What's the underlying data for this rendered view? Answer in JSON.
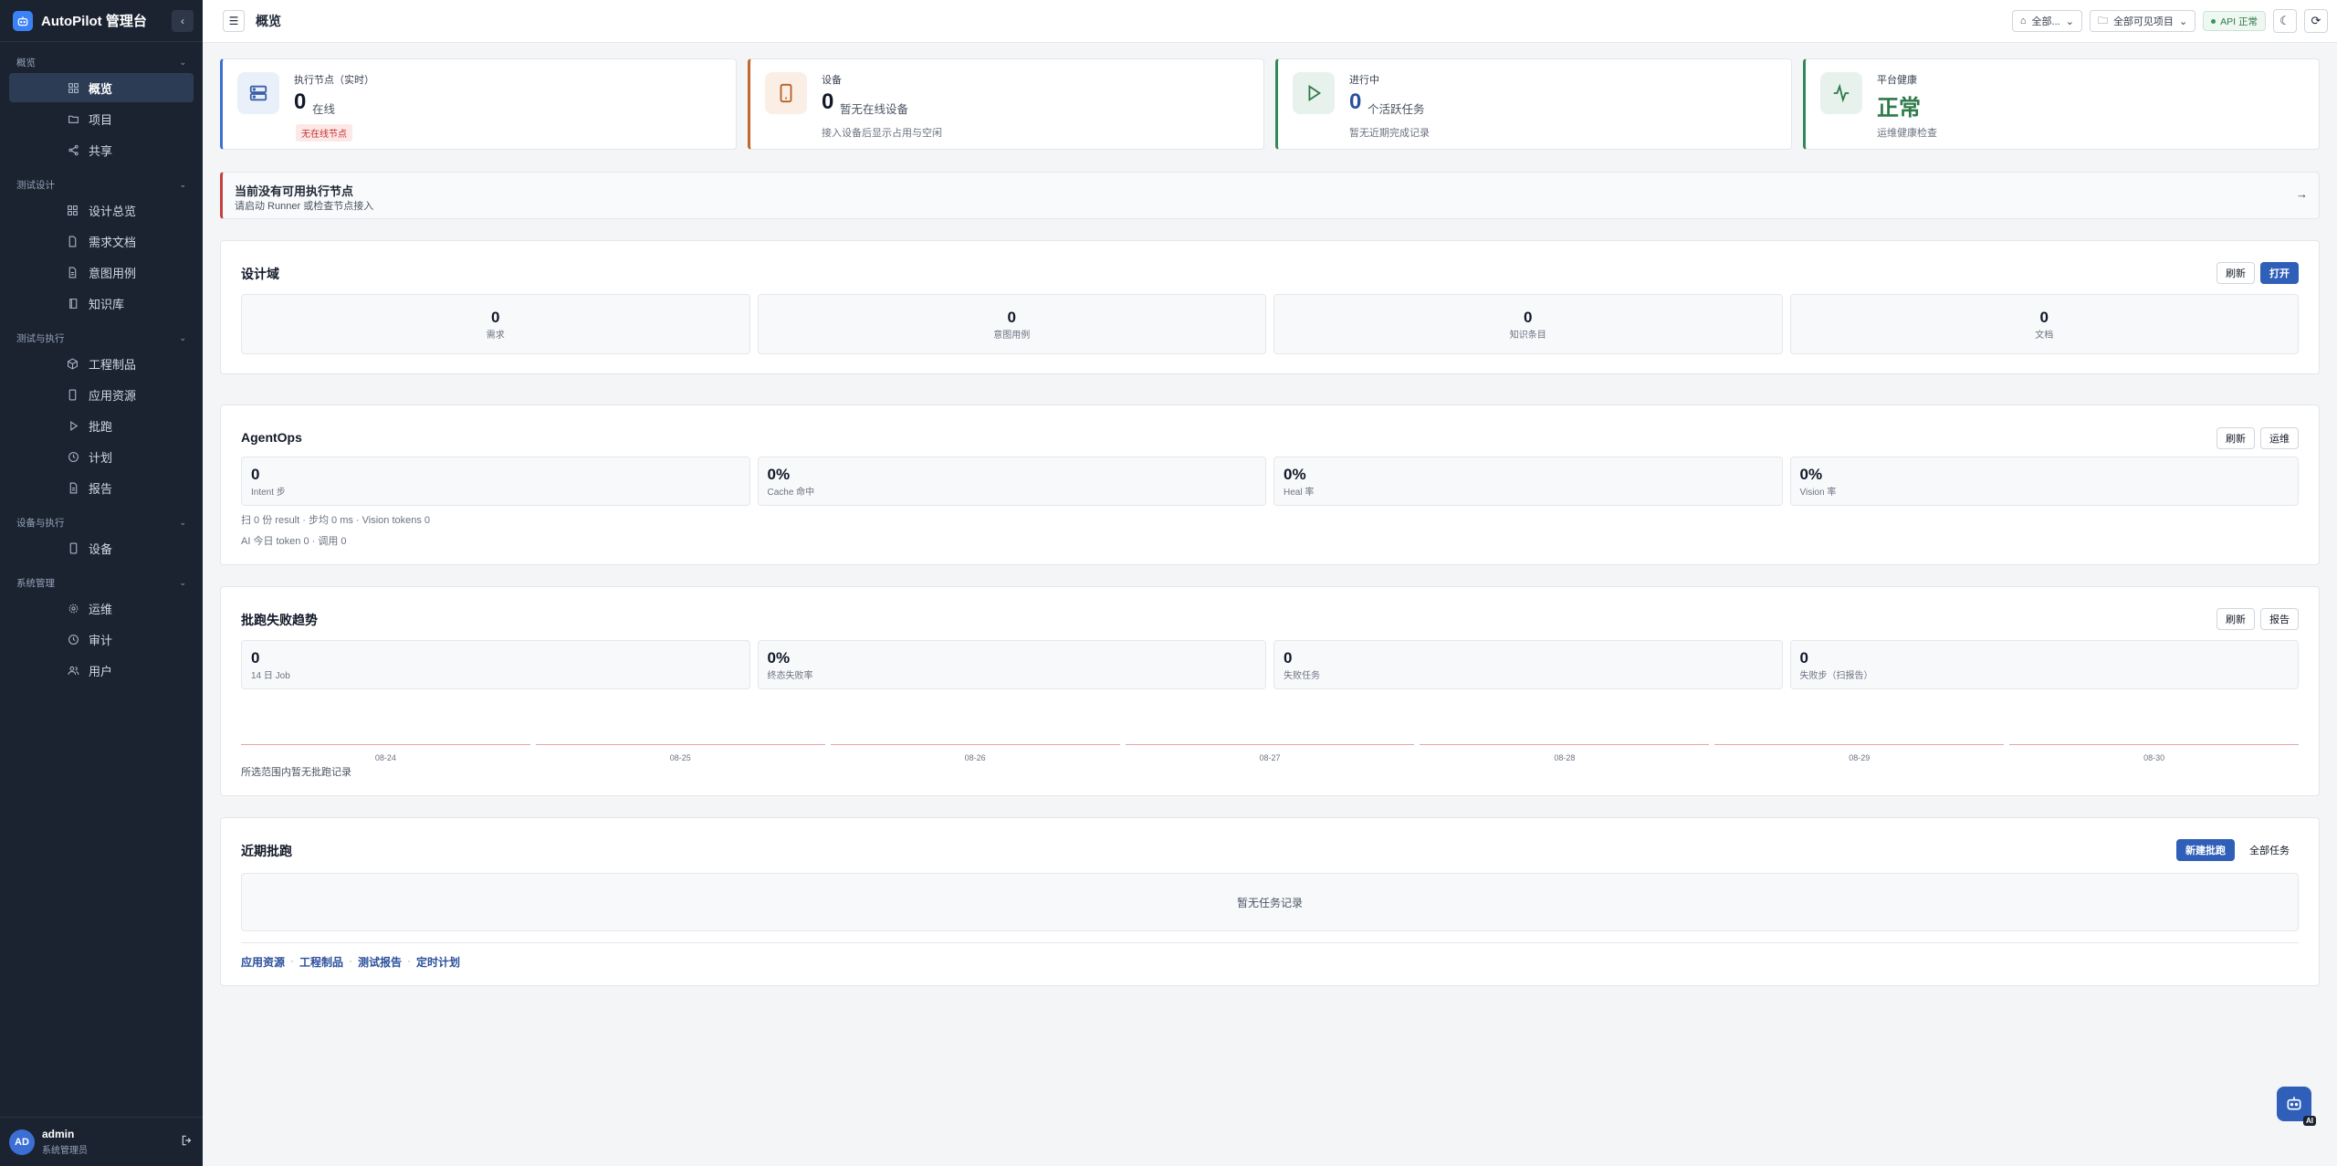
{
  "brand": {
    "title": "AutoPilot 管理台"
  },
  "sidebar": {
    "groups": [
      {
        "title": "概览",
        "items": [
          {
            "label": "概览",
            "icon": "grid-icon",
            "active": true
          },
          {
            "label": "项目",
            "icon": "folder-icon"
          },
          {
            "label": "共享",
            "icon": "share-icon"
          }
        ]
      },
      {
        "title": "测试设计",
        "items": [
          {
            "label": "设计总览",
            "icon": "grid-icon"
          },
          {
            "label": "需求文档",
            "icon": "file-icon"
          },
          {
            "label": "意图用例",
            "icon": "file-text-icon"
          },
          {
            "label": "知识库",
            "icon": "book-icon"
          }
        ]
      },
      {
        "title": "测试与执行",
        "items": [
          {
            "label": "工程制品",
            "icon": "box-icon"
          },
          {
            "label": "应用资源",
            "icon": "smartphone-icon"
          },
          {
            "label": "批跑",
            "icon": "play-icon"
          },
          {
            "label": "计划",
            "icon": "clock-icon"
          },
          {
            "label": "报告",
            "icon": "file-text-icon"
          }
        ]
      },
      {
        "title": "设备与执行",
        "items": [
          {
            "label": "设备",
            "icon": "smartphone-icon"
          }
        ]
      },
      {
        "title": "系统管理",
        "items": [
          {
            "label": "运维",
            "icon": "gear-icon"
          },
          {
            "label": "审计",
            "icon": "clock-icon"
          },
          {
            "label": "用户",
            "icon": "users-icon"
          }
        ]
      }
    ],
    "user": {
      "initials": "AD",
      "name": "admin",
      "role": "系统管理员"
    }
  },
  "topbar": {
    "page_title": "概览",
    "workspace_select": "全部...",
    "project_select": "全部可见项目",
    "api_status": "API 正常"
  },
  "stats": [
    {
      "label": "执行节点（实时）",
      "value": "0",
      "unit": "在线",
      "badge": "无在线节点"
    },
    {
      "label": "设备",
      "value": "0",
      "unit": "暂无在线设备",
      "sub": "接入设备后显示占用与空闲"
    },
    {
      "label": "进行中",
      "value": "0",
      "unit": "个活跃任务",
      "sub": "暂无近期完成记录"
    },
    {
      "label": "平台健康",
      "value": "正常",
      "sub": "运维健康检查"
    }
  ],
  "alert": {
    "title": "当前没有可用执行节点",
    "subtitle": "请启动 Runner 或检查节点接入",
    "arrow": "→"
  },
  "design": {
    "title": "设计域",
    "refresh": "刷新",
    "open": "打开",
    "tiles": [
      {
        "value": "0",
        "label": "需求"
      },
      {
        "value": "0",
        "label": "意图用例"
      },
      {
        "value": "0",
        "label": "知识条目"
      },
      {
        "value": "0",
        "label": "文档"
      }
    ]
  },
  "agentops": {
    "title": "AgentOps",
    "refresh": "刷新",
    "ops": "运维",
    "tiles": [
      {
        "value": "0",
        "label": "Intent 步"
      },
      {
        "value": "0%",
        "label": "Cache 命中"
      },
      {
        "value": "0%",
        "label": "Heal 率"
      },
      {
        "value": "0%",
        "label": "Vision 率"
      }
    ],
    "meta1": "扫 0 份 result · 步均 0 ms · Vision tokens 0",
    "meta2": "AI 今日 token 0 · 调用 0"
  },
  "trend": {
    "title": "批跑失败趋势",
    "refresh": "刷新",
    "report": "报告",
    "tiles": [
      {
        "value": "0",
        "label": "14 日 Job"
      },
      {
        "value": "0%",
        "label": "终态失败率"
      },
      {
        "value": "0",
        "label": "失败任务"
      },
      {
        "value": "0",
        "label": "失败步（扫报告）"
      }
    ],
    "dates": [
      "08-24",
      "08-25",
      "08-26",
      "08-27",
      "08-28",
      "08-29",
      "08-30"
    ],
    "empty": "所选范围内暂无批跑记录"
  },
  "recent": {
    "title": "近期批跑",
    "new_run": "新建批跑",
    "all_tasks": "全部任务",
    "empty": "暂无任务记录",
    "links": [
      "应用资源",
      "工程制品",
      "测试报告",
      "定时计划"
    ],
    "sep": "·"
  },
  "fab": {
    "tag": "AI"
  },
  "colors": {
    "accent": "#2f5fb8",
    "sidebar_bg": "#1b2331",
    "danger": "#c24141",
    "success": "#2f7a4a",
    "node_accent": "#3b6fd4",
    "device_accent": "#c2662b",
    "running_accent": "#2f8a5a"
  }
}
